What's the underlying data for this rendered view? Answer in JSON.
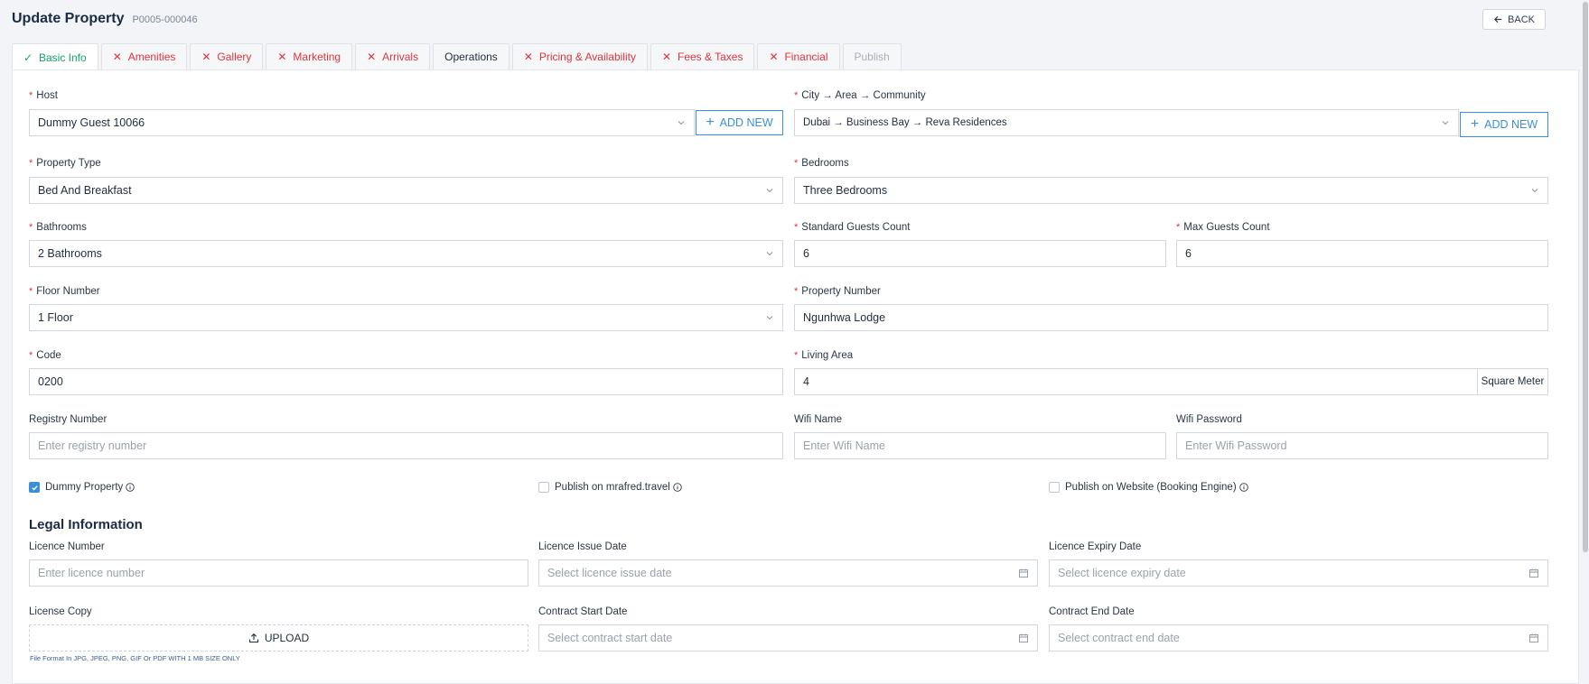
{
  "header": {
    "title": "Update Property",
    "code": "P0005-000046",
    "back_label": "BACK"
  },
  "tabs": [
    {
      "label": "Basic Info",
      "state": "done"
    },
    {
      "label": "Amenities",
      "state": "error"
    },
    {
      "label": "Gallery",
      "state": "error"
    },
    {
      "label": "Marketing",
      "state": "error"
    },
    {
      "label": "Arrivals",
      "state": "error"
    },
    {
      "label": "Operations",
      "state": "neutral"
    },
    {
      "label": "Pricing & Availability",
      "state": "error"
    },
    {
      "label": "Fees & Taxes",
      "state": "error"
    },
    {
      "label": "Financial",
      "state": "error"
    },
    {
      "label": "Publish",
      "state": "disabled"
    }
  ],
  "form": {
    "host": {
      "label": "Host",
      "value": "Dummy Guest 10066"
    },
    "city": {
      "label": "City → Area → Community",
      "value": "Dubai → Business Bay → Reva Residences"
    },
    "add_new_label": "ADD NEW",
    "property_type": {
      "label": "Property Type",
      "value": "Bed And Breakfast"
    },
    "bedrooms": {
      "label": "Bedrooms",
      "value": "Three Bedrooms"
    },
    "bathrooms": {
      "label": "Bathrooms",
      "value": "2 Bathrooms"
    },
    "standard_guests": {
      "label": "Standard Guests Count",
      "value": "6"
    },
    "max_guests": {
      "label": "Max Guests Count",
      "value": "6"
    },
    "floor_number": {
      "label": "Floor Number",
      "value": "1 Floor"
    },
    "property_number": {
      "label": "Property Number",
      "value": "Ngunhwa Lodge"
    },
    "code": {
      "label": "Code",
      "value": "0200"
    },
    "living_area": {
      "label": "Living Area",
      "value": "4",
      "unit": "Square Meter"
    },
    "registry_number": {
      "label": "Registry Number",
      "placeholder": "Enter registry number"
    },
    "wifi_name": {
      "label": "Wifi Name",
      "placeholder": "Enter Wifi Name"
    },
    "wifi_password": {
      "label": "Wifi Password",
      "placeholder": "Enter Wifi Password"
    },
    "dummy_property": {
      "label": "Dummy Property",
      "checked": true
    },
    "publish_mrafred": {
      "label": "Publish on mrafred.travel",
      "checked": false
    },
    "publish_website": {
      "label": "Publish on Website (Booking Engine)",
      "checked": false
    }
  },
  "legal": {
    "title": "Legal Information",
    "licence_number": {
      "label": "Licence Number",
      "placeholder": "Enter licence number"
    },
    "licence_issue_date": {
      "label": "Licence Issue Date",
      "placeholder": "Select licence issue date"
    },
    "licence_expiry_date": {
      "label": "Licence Expiry Date",
      "placeholder": "Select licence expiry date"
    },
    "license_copy": {
      "label": "License Copy",
      "upload_label": "UPLOAD",
      "hint": "File Format In JPG, JPEG, PNG, GIF Or PDF WITH 1 MB SIZE ONLY"
    },
    "contract_start": {
      "label": "Contract Start Date",
      "placeholder": "Select contract start date"
    },
    "contract_end": {
      "label": "Contract End Date",
      "placeholder": "Select contract end date"
    }
  },
  "colors": {
    "accent": "#3b8fd8",
    "success": "#14a26b",
    "error": "#e0343c"
  }
}
